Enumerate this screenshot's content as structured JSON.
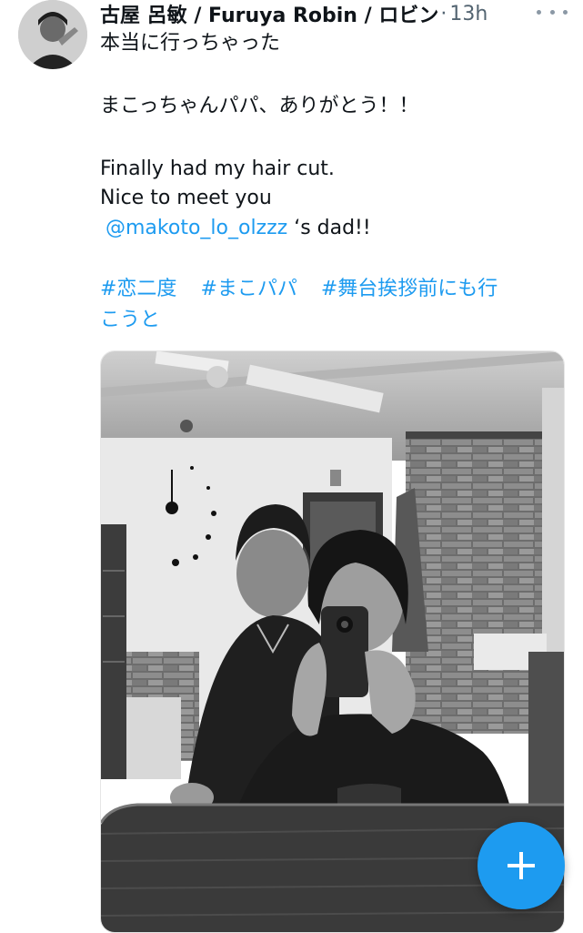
{
  "tweet": {
    "display_name": "古屋 呂敏 / Furuya Robin / ロビン",
    "separator": "·",
    "timestamp": "13h",
    "lines": {
      "l1": "本当に行っちゃった",
      "l2": "まこっちゃんパパ、ありがとう！！",
      "l3": "Finally had my hair cut.",
      "l4": "Nice to meet you",
      "mention": "@makoto_lo_olzzz",
      "mention_suffix": " ‘s dad!!"
    },
    "hashtags": {
      "h1": "#恋二度",
      "h2": "#まこパパ",
      "h3a": "#舞台挨拶前にも行",
      "h3b": "こうと"
    }
  },
  "icons": {
    "more": "more-icon",
    "compose": "plus-icon"
  },
  "colors": {
    "link": "#1d9bf0",
    "fab": "#1d9bf0",
    "meta": "#536471"
  }
}
